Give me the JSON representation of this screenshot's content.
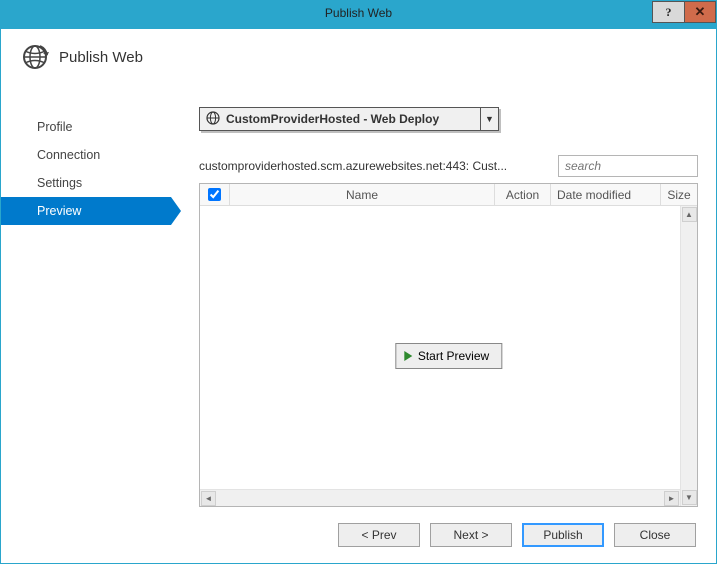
{
  "window": {
    "title": "Publish Web",
    "help_label": "?",
    "close_label": "✕"
  },
  "header": {
    "title": "Publish Web"
  },
  "sidebar": {
    "items": [
      {
        "label": "Profile",
        "active": false
      },
      {
        "label": "Connection",
        "active": false
      },
      {
        "label": "Settings",
        "active": false
      },
      {
        "label": "Preview",
        "active": true
      }
    ]
  },
  "dropdown": {
    "label": "CustomProviderHosted - Web Deploy"
  },
  "connection_text": "customproviderhosted.scm.azurewebsites.net:443: Cust...",
  "search": {
    "placeholder": "search",
    "value": ""
  },
  "grid": {
    "columns": {
      "name": "Name",
      "action": "Action",
      "date": "Date modified",
      "size": "Size"
    },
    "checkbox_checked": true
  },
  "start_preview_label": "Start Preview",
  "footer": {
    "prev": "< Prev",
    "next": "Next >",
    "publish": "Publish",
    "close": "Close"
  }
}
